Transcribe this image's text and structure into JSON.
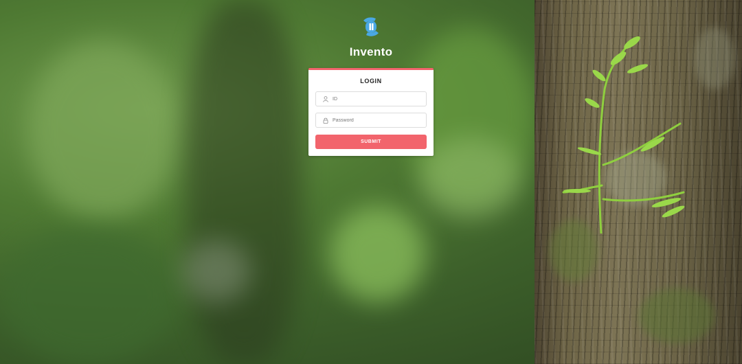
{
  "app": {
    "brand_name": "Invento",
    "logo_icon": "invento-logo-icon",
    "brand_color": "#4aa8e4"
  },
  "login": {
    "title": "LOGIN",
    "accent_color": "#f2646c",
    "id_field": {
      "placeholder": "ID",
      "value": "",
      "icon": "user-icon"
    },
    "password_field": {
      "placeholder": "Password",
      "value": "",
      "icon": "lock-icon"
    },
    "submit_label": "SUBMIT"
  },
  "background": {
    "description_icon": "forest-background-image"
  }
}
